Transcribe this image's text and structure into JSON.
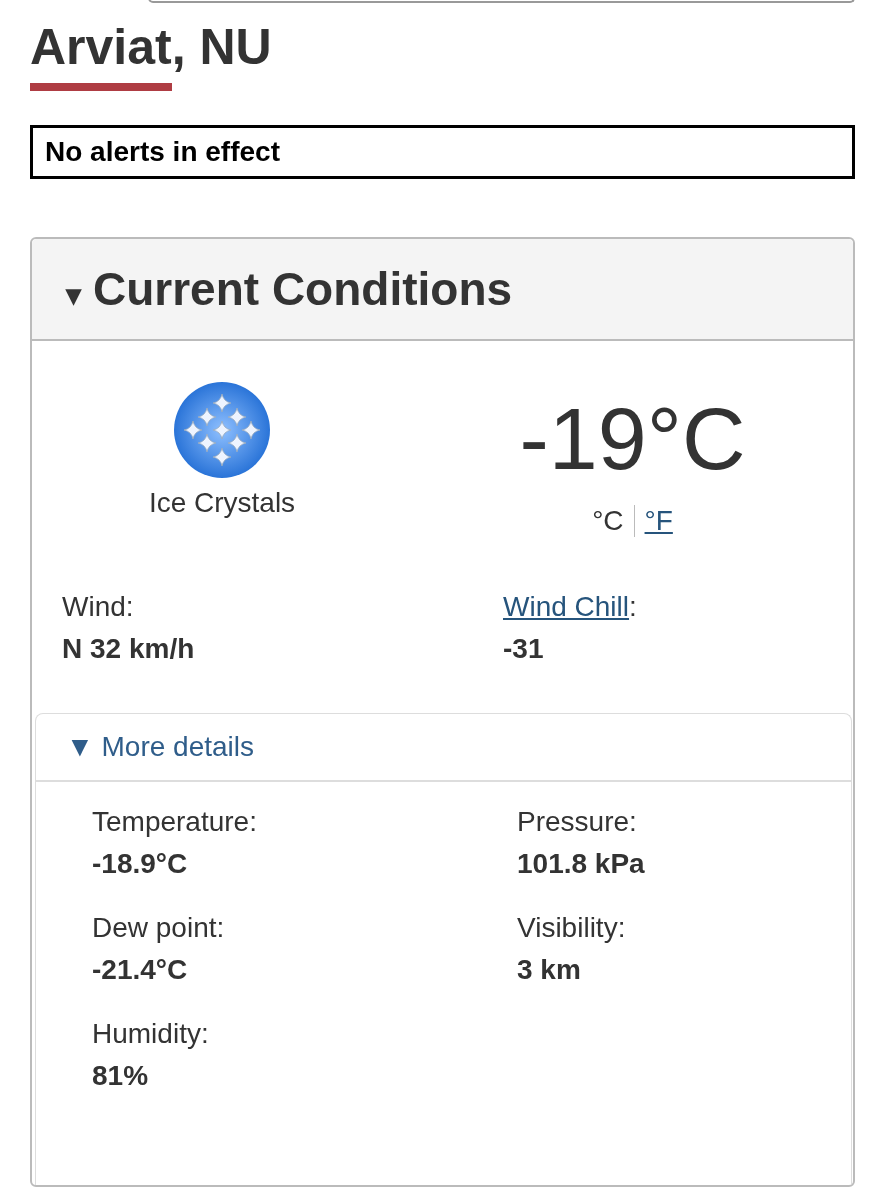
{
  "location": {
    "title": "Arviat, NU"
  },
  "alert": {
    "text": "No alerts in effect"
  },
  "current_conditions": {
    "heading_toggle": "▾",
    "heading": "Current Conditions",
    "condition": "Ice Crystals",
    "temperature": "-19°C",
    "units": [
      {
        "label": "°C",
        "selected": true
      },
      {
        "label": "°F",
        "selected": false
      }
    ],
    "summary": [
      {
        "label": "Wind:",
        "value": "N 32 km/h"
      },
      {
        "label": "Wind Chill",
        "label_suffix": ":",
        "link": true,
        "value": "-31"
      }
    ],
    "more_details": {
      "toggle": "▼",
      "label": "More details",
      "items": [
        {
          "label": "Temperature:",
          "value": "-18.9°C"
        },
        {
          "label": "Pressure:",
          "value": "101.8 kPa"
        },
        {
          "label": "Dew point:",
          "value": "-21.4°C"
        },
        {
          "label": "Visibility:",
          "value": "3 km"
        },
        {
          "label": "Humidity:",
          "value": "81%"
        }
      ]
    }
  }
}
